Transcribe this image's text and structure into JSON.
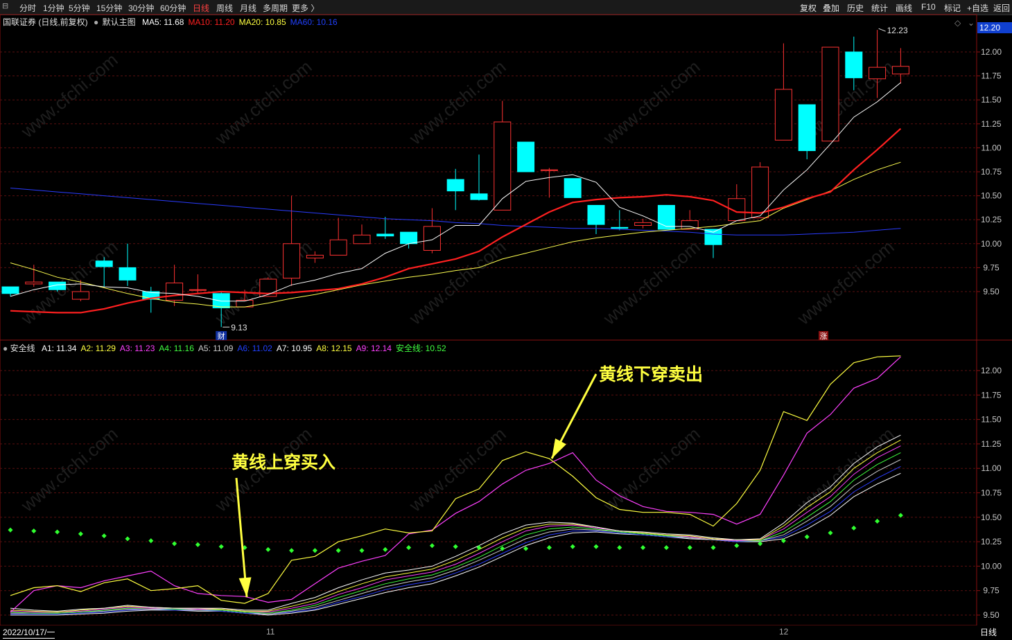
{
  "toolbar": {
    "left": [
      "分时",
      "1分钟",
      "5分钟",
      "15分钟",
      "30分钟",
      "60分钟",
      "日线",
      "周线",
      "月线",
      "多周期",
      "更多 〉"
    ],
    "active_index": 6,
    "right": [
      "复权",
      "叠加",
      "历史",
      "统计",
      "画线",
      "F10",
      "标记",
      "+自选",
      "返回"
    ]
  },
  "main": {
    "title": "国联证券 (日线,前复权)",
    "template": "默认主图",
    "ma": [
      {
        "label": "MA5: 11.68",
        "color": "#ffffff"
      },
      {
        "label": "MA10: 11.20",
        "color": "#ff2020"
      },
      {
        "label": "MA20: 10.85",
        "color": "#ffff40"
      },
      {
        "label": "MA60: 10.16",
        "color": "#2040ff"
      }
    ],
    "price_axis": [
      "12.00",
      "11.75",
      "11.50",
      "11.25",
      "11.00",
      "10.75",
      "10.50",
      "10.25",
      "10.00",
      "9.75",
      "9.50"
    ],
    "current_price": "12.20",
    "high_label": "12.23",
    "low_label": "9.13",
    "cai_mark": "财",
    "zhang_mark": "涨"
  },
  "indicator": {
    "name": "安全线",
    "values": [
      {
        "label": "A1: 11.34",
        "color": "#ffffff"
      },
      {
        "label": "A2: 11.29",
        "color": "#ffff40"
      },
      {
        "label": "A3: 11.23",
        "color": "#ff40ff"
      },
      {
        "label": "A4: 11.16",
        "color": "#40ff40"
      },
      {
        "label": "A5: 11.09",
        "color": "#cccccc"
      },
      {
        "label": "A6: 11.02",
        "color": "#2040ff"
      },
      {
        "label": "A7: 10.95",
        "color": "#ffffff"
      },
      {
        "label": "A8: 12.15",
        "color": "#ffff40"
      },
      {
        "label": "A9: 12.14",
        "color": "#ff40ff"
      },
      {
        "label": "安全线: 10.52",
        "color": "#40ff40"
      }
    ],
    "axis": [
      "12.00",
      "11.75",
      "11.50",
      "11.25",
      "11.00",
      "10.75",
      "10.50",
      "10.25",
      "10.00",
      "9.75",
      "9.50"
    ]
  },
  "annotations": {
    "sell": "黄线下穿卖出",
    "buy": "黄线上穿买入"
  },
  "bottom": {
    "date": "2022/10/17/一",
    "month_labels": [
      "11",
      "12"
    ],
    "period_button": "日线"
  },
  "watermark": "www.cfchi.com",
  "chart_data": {
    "type": "candlestick",
    "title": "国联证券 (日线,前复权)",
    "candles": [
      {
        "o": 9.55,
        "h": 9.55,
        "l": 9.45,
        "c": 9.48
      },
      {
        "o": 9.58,
        "h": 9.78,
        "l": 9.55,
        "c": 9.6
      },
      {
        "o": 9.6,
        "h": 9.6,
        "l": 9.5,
        "c": 9.52
      },
      {
        "o": 9.42,
        "h": 9.62,
        "l": 9.4,
        "c": 9.5
      },
      {
        "o": 9.82,
        "h": 9.86,
        "l": 9.55,
        "c": 9.76
      },
      {
        "o": 9.75,
        "h": 10.0,
        "l": 9.56,
        "c": 9.62
      },
      {
        "o": 9.5,
        "h": 9.55,
        "l": 9.28,
        "c": 9.42
      },
      {
        "o": 9.41,
        "h": 9.78,
        "l": 9.35,
        "c": 9.59
      },
      {
        "o": 9.52,
        "h": 9.68,
        "l": 9.48,
        "c": 9.52
      },
      {
        "o": 9.48,
        "h": 9.5,
        "l": 9.13,
        "c": 9.33
      },
      {
        "o": 9.34,
        "h": 9.52,
        "l": 9.34,
        "c": 9.41
      },
      {
        "o": 9.45,
        "h": 9.65,
        "l": 9.45,
        "c": 9.63
      },
      {
        "o": 9.64,
        "h": 10.5,
        "l": 9.56,
        "c": 10.0
      },
      {
        "o": 9.85,
        "h": 9.92,
        "l": 9.8,
        "c": 9.88
      },
      {
        "o": 9.88,
        "h": 10.27,
        "l": 9.88,
        "c": 10.04
      },
      {
        "o": 10.0,
        "h": 10.2,
        "l": 10.0,
        "c": 10.09
      },
      {
        "o": 10.1,
        "h": 10.28,
        "l": 10.05,
        "c": 10.08
      },
      {
        "o": 10.12,
        "h": 10.12,
        "l": 9.95,
        "c": 10.0
      },
      {
        "o": 9.93,
        "h": 10.37,
        "l": 9.9,
        "c": 10.18
      },
      {
        "o": 10.67,
        "h": 10.78,
        "l": 10.35,
        "c": 10.55
      },
      {
        "o": 10.52,
        "h": 10.93,
        "l": 10.45,
        "c": 10.46
      },
      {
        "o": 10.35,
        "h": 11.49,
        "l": 10.35,
        "c": 11.27
      },
      {
        "o": 11.06,
        "h": 11.06,
        "l": 10.78,
        "c": 10.75
      },
      {
        "o": 10.77,
        "h": 10.79,
        "l": 10.48,
        "c": 10.77
      },
      {
        "o": 10.68,
        "h": 10.68,
        "l": 10.48,
        "c": 10.48
      },
      {
        "o": 10.4,
        "h": 10.4,
        "l": 10.1,
        "c": 10.2
      },
      {
        "o": 10.17,
        "h": 10.35,
        "l": 10.14,
        "c": 10.16
      },
      {
        "o": 10.19,
        "h": 10.26,
        "l": 10.16,
        "c": 10.22
      },
      {
        "o": 10.4,
        "h": 10.4,
        "l": 10.15,
        "c": 10.15
      },
      {
        "o": 10.15,
        "h": 10.35,
        "l": 10.15,
        "c": 10.24
      },
      {
        "o": 10.15,
        "h": 10.15,
        "l": 9.85,
        "c": 9.99
      },
      {
        "o": 10.24,
        "h": 10.62,
        "l": 10.24,
        "c": 10.47
      },
      {
        "o": 10.27,
        "h": 10.85,
        "l": 10.27,
        "c": 10.8
      },
      {
        "o": 11.08,
        "h": 12.09,
        "l": 11.08,
        "c": 11.61
      },
      {
        "o": 11.45,
        "h": 11.45,
        "l": 10.88,
        "c": 10.97
      },
      {
        "o": 11.07,
        "h": 12.05,
        "l": 11.07,
        "c": 12.05
      },
      {
        "o": 12.0,
        "h": 12.16,
        "l": 11.6,
        "c": 11.73
      },
      {
        "o": 11.72,
        "h": 12.23,
        "l": 11.52,
        "c": 11.84
      },
      {
        "o": 11.77,
        "h": 12.04,
        "l": 11.67,
        "c": 11.85
      }
    ],
    "ma5": [
      9.45,
      9.52,
      9.57,
      9.58,
      9.55,
      9.54,
      9.49,
      9.48,
      9.45,
      9.4,
      9.4,
      9.47,
      9.57,
      9.62,
      9.69,
      9.74,
      9.9,
      10.0,
      10.04,
      10.19,
      10.19,
      10.47,
      10.65,
      10.69,
      10.72,
      10.64,
      10.38,
      10.29,
      10.18,
      10.18,
      10.12,
      10.24,
      10.29,
      10.56,
      10.77,
      11.04,
      11.32,
      11.48,
      11.68
    ],
    "ma10": [
      9.3,
      9.29,
      9.28,
      9.28,
      9.32,
      9.38,
      9.43,
      9.46,
      9.48,
      9.5,
      9.49,
      9.48,
      9.49,
      9.51,
      9.53,
      9.58,
      9.65,
      9.74,
      9.79,
      9.84,
      9.92,
      10.07,
      10.2,
      10.33,
      10.43,
      10.46,
      10.48,
      10.49,
      10.51,
      10.49,
      10.45,
      10.33,
      10.32,
      10.38,
      10.47,
      10.54,
      10.77,
      10.98,
      11.2
    ],
    "ma20": [
      9.8,
      9.73,
      9.65,
      9.6,
      9.54,
      9.48,
      9.43,
      9.39,
      9.37,
      9.34,
      9.34,
      9.38,
      9.43,
      9.47,
      9.52,
      9.57,
      9.61,
      9.65,
      9.68,
      9.72,
      9.75,
      9.84,
      9.9,
      9.96,
      10.02,
      10.06,
      10.09,
      10.12,
      10.14,
      10.16,
      10.18,
      10.21,
      10.24,
      10.37,
      10.46,
      10.55,
      10.67,
      10.77,
      10.85
    ],
    "ma60": [
      10.58,
      10.56,
      10.54,
      10.52,
      10.5,
      10.48,
      10.46,
      10.44,
      10.42,
      10.4,
      10.38,
      10.36,
      10.34,
      10.32,
      10.3,
      10.28,
      10.26,
      10.25,
      10.24,
      10.22,
      10.21,
      10.19,
      10.18,
      10.17,
      10.16,
      10.16,
      10.15,
      10.14,
      10.13,
      10.12,
      10.1,
      10.09,
      10.09,
      10.09,
      10.1,
      10.11,
      10.12,
      10.14,
      10.16
    ],
    "indicator": {
      "A1": [
        9.57,
        9.55,
        9.54,
        9.56,
        9.57,
        9.6,
        9.58,
        9.57,
        9.57,
        9.57,
        9.55,
        9.55,
        9.62,
        9.68,
        9.78,
        9.86,
        9.93,
        9.96,
        10.0,
        10.1,
        10.21,
        10.33,
        10.42,
        10.45,
        10.44,
        10.4,
        10.36,
        10.35,
        10.33,
        10.32,
        10.29,
        10.27,
        10.28,
        10.44,
        10.65,
        10.81,
        11.05,
        11.22,
        11.34
      ],
      "A2": [
        9.55,
        9.54,
        9.53,
        9.55,
        9.57,
        9.59,
        9.58,
        9.57,
        9.57,
        9.56,
        9.54,
        9.54,
        9.59,
        9.65,
        9.74,
        9.82,
        9.89,
        9.93,
        9.97,
        10.06,
        10.17,
        10.29,
        10.39,
        10.43,
        10.43,
        10.4,
        10.36,
        10.34,
        10.32,
        10.31,
        10.28,
        10.27,
        10.27,
        10.41,
        10.6,
        10.76,
        11.0,
        11.16,
        11.29
      ],
      "A3": [
        9.54,
        9.53,
        9.53,
        9.54,
        9.56,
        9.58,
        9.57,
        9.57,
        9.56,
        9.56,
        9.54,
        9.53,
        9.57,
        9.62,
        9.71,
        9.78,
        9.86,
        9.9,
        9.94,
        10.02,
        10.13,
        10.25,
        10.36,
        10.41,
        10.42,
        10.39,
        10.36,
        10.34,
        10.32,
        10.3,
        10.28,
        10.26,
        10.27,
        10.38,
        10.55,
        10.71,
        10.94,
        11.11,
        11.23
      ],
      "A4": [
        9.53,
        9.52,
        9.52,
        9.53,
        9.55,
        9.57,
        9.57,
        9.56,
        9.56,
        9.55,
        9.53,
        9.52,
        9.55,
        9.6,
        9.68,
        9.75,
        9.82,
        9.87,
        9.91,
        9.99,
        10.09,
        10.21,
        10.32,
        10.38,
        10.4,
        10.38,
        10.35,
        10.33,
        10.31,
        10.3,
        10.28,
        10.26,
        10.26,
        10.35,
        10.5,
        10.66,
        10.88,
        11.04,
        11.16
      ],
      "A5": [
        9.52,
        9.52,
        9.52,
        9.53,
        9.54,
        9.56,
        9.56,
        9.56,
        9.55,
        9.55,
        9.53,
        9.51,
        9.54,
        9.58,
        9.65,
        9.72,
        9.79,
        9.84,
        9.88,
        9.96,
        10.06,
        10.17,
        10.28,
        10.35,
        10.38,
        10.37,
        10.35,
        10.33,
        10.31,
        10.29,
        10.27,
        10.26,
        10.26,
        10.32,
        10.46,
        10.61,
        10.82,
        10.97,
        11.09
      ],
      "A6": [
        9.51,
        9.51,
        9.51,
        9.52,
        9.53,
        9.55,
        9.56,
        9.55,
        9.55,
        9.54,
        9.52,
        9.51,
        9.53,
        9.56,
        9.63,
        9.69,
        9.76,
        9.81,
        9.85,
        9.93,
        10.02,
        10.13,
        10.24,
        10.32,
        10.36,
        10.36,
        10.34,
        10.32,
        10.3,
        10.29,
        10.27,
        10.25,
        10.26,
        10.3,
        10.42,
        10.56,
        10.76,
        10.9,
        11.02
      ],
      "A7": [
        9.5,
        9.5,
        9.5,
        9.51,
        9.52,
        9.54,
        9.55,
        9.55,
        9.54,
        9.54,
        9.52,
        9.5,
        9.52,
        9.55,
        9.61,
        9.67,
        9.73,
        9.78,
        9.82,
        9.9,
        9.99,
        10.1,
        10.21,
        10.29,
        10.34,
        10.35,
        10.33,
        10.32,
        10.3,
        10.28,
        10.27,
        10.25,
        10.25,
        10.28,
        10.38,
        10.52,
        10.71,
        10.84,
        10.95
      ],
      "A8": [
        9.7,
        9.78,
        9.8,
        9.74,
        9.83,
        9.87,
        9.75,
        9.77,
        9.8,
        9.65,
        9.62,
        9.72,
        10.06,
        10.1,
        10.25,
        10.31,
        10.38,
        10.34,
        10.36,
        10.69,
        10.79,
        11.08,
        11.17,
        11.1,
        10.92,
        10.7,
        10.58,
        10.55,
        10.55,
        10.53,
        10.41,
        10.64,
        10.98,
        11.58,
        11.49,
        11.86,
        12.08,
        12.14,
        12.15
      ],
      "A9": [
        9.53,
        9.75,
        9.8,
        9.78,
        9.85,
        9.9,
        9.95,
        9.8,
        9.72,
        9.7,
        9.69,
        9.63,
        9.66,
        9.82,
        9.98,
        10.05,
        10.11,
        10.33,
        10.37,
        10.54,
        10.66,
        10.84,
        10.98,
        11.05,
        11.16,
        10.88,
        10.72,
        10.61,
        10.56,
        10.55,
        10.53,
        10.43,
        10.53,
        10.93,
        11.36,
        11.55,
        11.82,
        11.92,
        12.14
      ],
      "safe": [
        10.37,
        10.36,
        10.35,
        10.33,
        10.31,
        10.28,
        10.26,
        10.23,
        10.22,
        10.2,
        10.19,
        10.17,
        10.16,
        10.16,
        10.16,
        10.16,
        10.17,
        10.19,
        10.21,
        10.2,
        10.19,
        10.18,
        10.18,
        10.19,
        10.2,
        10.2,
        10.19,
        10.19,
        10.19,
        10.19,
        10.19,
        10.21,
        10.23,
        10.26,
        10.3,
        10.34,
        10.39,
        10.46,
        10.52
      ]
    },
    "ylim_main": [
      9.13,
      12.23
    ],
    "ylim_indicator": [
      9.45,
      12.2
    ]
  }
}
